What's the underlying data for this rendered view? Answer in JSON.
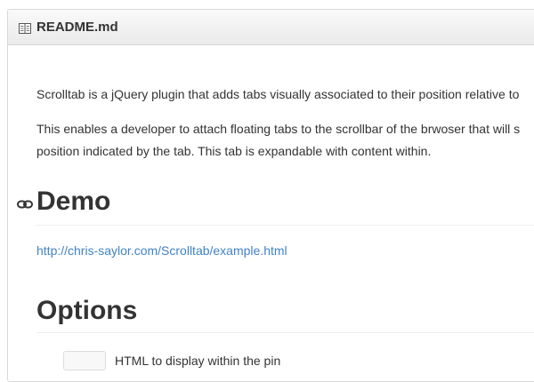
{
  "header": {
    "title": "README.md",
    "icon": "book-icon"
  },
  "readme": {
    "intro": "Scrolltab is a jQuery plugin that adds tabs visually associated to their position relative to",
    "desc_line1": "This enables a developer to attach floating tabs to the scrollbar of the brwoser that will s",
    "desc_line2": "position indicated by the tab. This tab is expandable with content within.",
    "demo_heading": "Demo",
    "anchor_icon": "link-anchor-icon",
    "demo_link": "http://chris-saylor.com/Scrolltab/example.html",
    "options_heading": "Options",
    "option_text": "HTML to display within the pin"
  },
  "colors": {
    "link": "#4183c4",
    "text": "#333333",
    "border": "#d8d8d8"
  }
}
